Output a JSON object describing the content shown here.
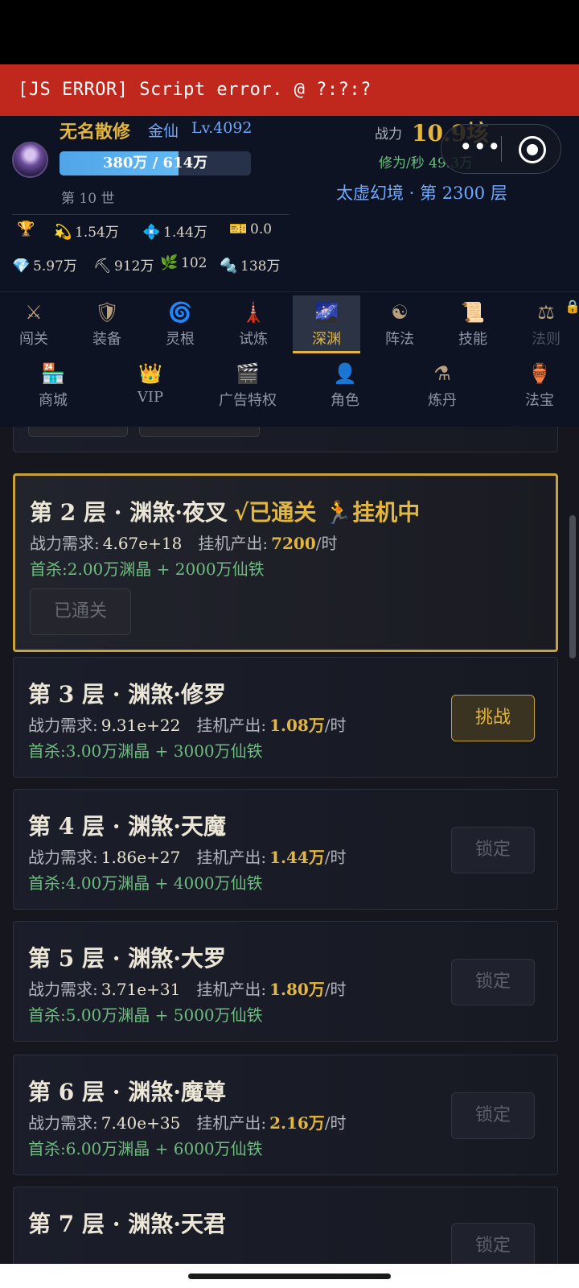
{
  "error_bar": {
    "text": "[JS ERROR] Script error. @ ?:?:?"
  },
  "player": {
    "name": "无名散修",
    "realm": "金仙",
    "level": "Lv.4092",
    "exp_text": "380万 / 614万",
    "exp_progress": 0.62,
    "generation": "第 10 世"
  },
  "stats": {
    "power_label": "战力",
    "power_value": "10.9垓",
    "cultivation_rate": "修为/秒 49.3万",
    "realm_floor": "太虚幻境 · 第 2300 层"
  },
  "resources": [
    {
      "icon": "trophy-icon",
      "glyph": "🏆",
      "value": ""
    },
    {
      "icon": "sparkle-star-icon",
      "glyph": "💫",
      "value": "1.54万"
    },
    {
      "icon": "diamond-shape-icon",
      "glyph": "💠",
      "value": "1.44万"
    },
    {
      "icon": "ticket-icon",
      "glyph": "🎫",
      "value": "0.0"
    },
    {
      "icon": "gem-icon",
      "glyph": "💎",
      "value": "5.97万"
    },
    {
      "icon": "pickaxe-icon",
      "glyph": "⛏",
      "value": "912万"
    },
    {
      "icon": "herb-icon",
      "glyph": "🌿",
      "value": "102"
    },
    {
      "icon": "nut-bolt-icon",
      "glyph": "🔩",
      "value": "138万"
    }
  ],
  "nav_row1": [
    {
      "label": "闯关",
      "icon": "crossed-swords-icon",
      "glyph": "⚔"
    },
    {
      "label": "装备",
      "icon": "shield-icon",
      "glyph": "🛡"
    },
    {
      "label": "灵根",
      "icon": "cyclone-icon",
      "glyph": "🌀"
    },
    {
      "label": "试炼",
      "icon": "tower-icon",
      "glyph": "🗼"
    },
    {
      "label": "深渊",
      "icon": "galaxy-icon",
      "glyph": "🌌",
      "active": true
    },
    {
      "label": "阵法",
      "icon": "yin-yang-icon",
      "glyph": "☯"
    },
    {
      "label": "技能",
      "icon": "scroll-icon",
      "glyph": "📜"
    },
    {
      "label": "法则",
      "icon": "scales-icon",
      "glyph": "⚖",
      "locked": true
    }
  ],
  "nav_row2": [
    {
      "label": "商城",
      "icon": "shop-icon",
      "glyph": "🏪"
    },
    {
      "label": "VIP",
      "icon": "crown-icon",
      "glyph": "👑"
    },
    {
      "label": "广告特权",
      "icon": "clapper-icon",
      "glyph": "🎬"
    },
    {
      "label": "角色",
      "icon": "person-icon",
      "glyph": "👤"
    },
    {
      "label": "炼丹",
      "icon": "alembic-icon",
      "glyph": "⚗"
    },
    {
      "label": "法宝",
      "icon": "vase-icon",
      "glyph": "🏺"
    }
  ],
  "floors": [
    {
      "title": "第 2 层 · 渊煞·夜叉",
      "passed_tag": "√已通关",
      "idle_tag": "🏃挂机中",
      "power_req_label": "战力需求:",
      "power_req": "4.67e+18",
      "output_label": "挂机产出:",
      "output": "7200",
      "output_unit": "/时",
      "reward": "首杀:2.00万渊晶 + 2000万仙铁",
      "button": "已通关",
      "state": "current"
    },
    {
      "title": "第 3 层 · 渊煞·修罗",
      "power_req_label": "战力需求:",
      "power_req": "9.31e+22",
      "output_label": "挂机产出:",
      "output": "1.08万",
      "output_unit": "/时",
      "reward": "首杀:3.00万渊晶 + 3000万仙铁",
      "button": "挑战",
      "state": "challenge"
    },
    {
      "title": "第 4 层 · 渊煞·天魔",
      "power_req_label": "战力需求:",
      "power_req": "1.86e+27",
      "output_label": "挂机产出:",
      "output": "1.44万",
      "output_unit": "/时",
      "reward": "首杀:4.00万渊晶 + 4000万仙铁",
      "button": "锁定",
      "state": "locked"
    },
    {
      "title": "第 5 层 · 渊煞·大罗",
      "power_req_label": "战力需求:",
      "power_req": "3.71e+31",
      "output_label": "挂机产出:",
      "output": "1.80万",
      "output_unit": "/时",
      "reward": "首杀:5.00万渊晶 + 5000万仙铁",
      "button": "锁定",
      "state": "locked"
    },
    {
      "title": "第 6 层 · 渊煞·魔尊",
      "power_req_label": "战力需求:",
      "power_req": "7.40e+35",
      "output_label": "挂机产出:",
      "output": "2.16万",
      "output_unit": "/时",
      "reward": "首杀:6.00万渊晶 + 6000万仙铁",
      "button": "锁定",
      "state": "locked"
    },
    {
      "title": "第 7 层 · 渊煞·天君",
      "button": "锁定",
      "state": "locked"
    }
  ]
}
